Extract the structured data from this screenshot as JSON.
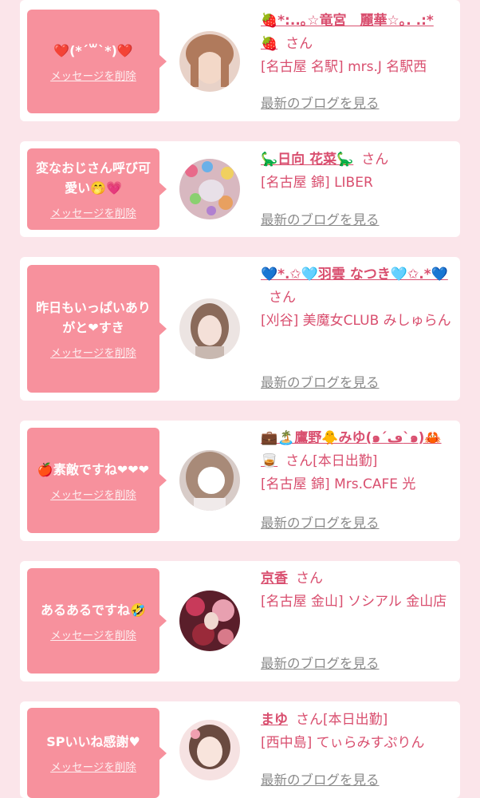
{
  "san_label": "さん",
  "delete_label": "メッセージを削除",
  "blog_label": "最新のブログを見る",
  "items": [
    {
      "message": "❤️(*´꒳`*)❤️",
      "name": "🍓*:..｡☆竜宮　麗華☆｡. .:* 🍓",
      "status": "",
      "shop": "[名古屋 名駅] mrs.J 名駅西",
      "avatar_color": "#c89a8a"
    },
    {
      "message": "変なおじさん呼び可愛い🤭💗",
      "name": "🦕日向 花菜🦕",
      "status": "",
      "shop": "[名古屋 錦] LIBER",
      "avatar_color": "#d8a8b0"
    },
    {
      "message": "昨日もいっぱいありがと❤すき",
      "name": "💙*.✩🩵羽雲 なつき🩵✩.*💙",
      "status": "",
      "shop": "[刈谷] 美魔女CLUB みしゅらん",
      "avatar_color": "#d9c9c4"
    },
    {
      "message": "🍎素敵ですね❤❤❤",
      "name": "💼🏝️鷹野🐥みゆ(๑´ڡ`๑)🦀🥃",
      "status": "[本日出勤]",
      "shop": "[名古屋 錦] Mrs.CAFE 光",
      "avatar_color": "#b89a8a"
    },
    {
      "message": "あるあるですね🤣",
      "name": "京香",
      "status": "",
      "shop": "[名古屋 金山] ソシアル 金山店",
      "avatar_color": "#8a3a4a"
    },
    {
      "message": "SPいいね感謝♥",
      "name": "まゆ",
      "status": "[本日出勤]",
      "shop": "[西中島] てぃらみすぷりん",
      "avatar_color": "#f0c8c8"
    }
  ]
}
